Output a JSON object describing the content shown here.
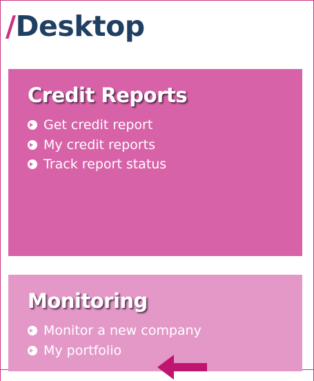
{
  "page": {
    "title_slash": "/",
    "title_text": "Desktop"
  },
  "panels": [
    {
      "title": "Credit Reports",
      "color": "#d862a8",
      "links": [
        "Get credit report",
        "My credit reports",
        "Track report status"
      ]
    },
    {
      "title": "Monitoring",
      "color": "#e498c8",
      "links": [
        "Monitor a new company",
        "My portfolio"
      ]
    }
  ],
  "colors": {
    "accent": "#c8327e",
    "title_text": "#1f3f63",
    "arrow": "#c0156e"
  },
  "icons": {
    "link_bullet": "circle-chevron-right-icon",
    "pointer": "left-arrow-icon"
  }
}
